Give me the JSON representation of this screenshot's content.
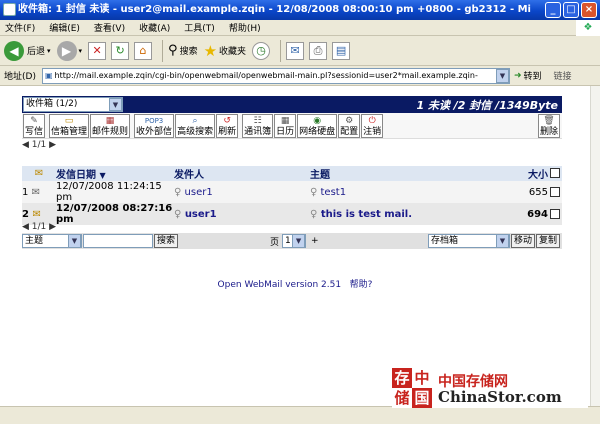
{
  "window": {
    "title": "收件箱: 1 封信 未读 - user2@mail.example.zqin - 12/08/2008 08:00:10 pm +0800 - gb2312 - Mi"
  },
  "menu": [
    "文件(F)",
    "编辑(E)",
    "查看(V)",
    "收藏(A)",
    "工具(T)",
    "帮助(H)"
  ],
  "toolbar": {
    "back": "后退",
    "search": "搜索",
    "favorites": "收藏夹"
  },
  "address": {
    "label": "地址(D)",
    "url": "http://mail.example.zqin/cgi-bin/openwebmail/openwebmail-main.pl?sessionid=user2*mail.example.zqin-",
    "go": "转到",
    "links": "链接"
  },
  "mail": {
    "folder_select": "收件箱 (1/2)",
    "stats": "1 未读 /2 封信 /1349Byte",
    "buttons": [
      "写信",
      "信箱管理",
      "邮件规则",
      "收外部信",
      "高级搜索",
      "刷新",
      "通讯簿",
      "日历",
      "网络硬盘",
      "配置",
      "注销"
    ],
    "delete": "删除",
    "page_top": "1/1",
    "headers": {
      "date": "发信日期",
      "from": "发件人",
      "subject": "主题",
      "size": "大小"
    },
    "rows": [
      {
        "num": "1",
        "date": "12/07/2008 11:24:15 pm",
        "from": "user1",
        "subject": "test1",
        "size": "655"
      },
      {
        "num": "2",
        "date": "12/07/2008 08:27:16 pm",
        "from": "user1",
        "subject": "this is test mail.",
        "size": "694"
      }
    ],
    "page_bottom": "1/1",
    "search_field": "主题",
    "search_button": "搜索",
    "page_label": "页",
    "page_num": "1",
    "plus": "+",
    "move_target": "存档箱",
    "move_button": "移动",
    "copy_button": "复制",
    "footer": "Open WebMail version 2.51",
    "help": "帮助?"
  },
  "watermark": {
    "seal": [
      "存",
      "中",
      "储",
      "国"
    ],
    "cn": "中国存储网",
    "en": "ChinaStor.com"
  }
}
